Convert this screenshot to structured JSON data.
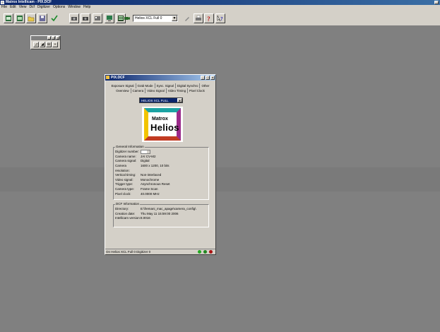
{
  "app": {
    "title": "Matrox Intellicam - PIX.DCF"
  },
  "menu": [
    "File",
    "Edit",
    "View",
    "Dcf",
    "Digitizer",
    "Options",
    "Window",
    "Help"
  ],
  "toolbar": {
    "digitizer_combo": "Helios XCL Full 0",
    "combo_arrow": "▼"
  },
  "palette": {
    "buttons": [
      "◿",
      "◢",
      "⊞",
      "▪"
    ],
    "ctrl": [
      "_",
      "□",
      "×"
    ]
  },
  "dcf_window": {
    "title": "PIX.DCF",
    "controls": [
      "_",
      "□",
      "×"
    ],
    "tabs_row1": [
      "Exposure Signal",
      "Grab Mode",
      "Sync. Signal",
      "Digital Synchro",
      "Other"
    ],
    "tabs_row2": [
      "Overview",
      "Camera",
      "Video Signal",
      "Video Timing",
      "Pixel Clock"
    ],
    "board": "HELIOS XCL FULL",
    "board_arrow": "▼",
    "logo_top": "Matrox",
    "logo_main": "Helios",
    "general": {
      "title": "General Information",
      "rows": [
        {
          "k": "Digitizer number:",
          "v": ""
        },
        {
          "k": "Camera name:",
          "v": "JAI CV-M2"
        },
        {
          "k": "Camera signal:",
          "v": "Digital"
        },
        {
          "k": "Camera resolution:",
          "v": "1600 x 1200, 10 bits"
        },
        {
          "k": "Vertical timing:",
          "v": "Non-interlaced"
        },
        {
          "k": "Video signal:",
          "v": "Monochrome"
        },
        {
          "k": "Trigger type:",
          "v": "Asynchronous Reset"
        },
        {
          "k": "Camera type:",
          "v": "Frame Scan"
        },
        {
          "k": "Pixel clock:",
          "v": "40.0000 MHz"
        }
      ]
    },
    "dcf": {
      "title": "DCF Information",
      "rows": [
        {
          "k": "Directory:",
          "v": "E:\\fremani_mac_apage\\camera_config\\"
        },
        {
          "k": "Creation date:",
          "v": "Thu May 11 15:59:00 2006"
        },
        {
          "k": "Intellicam version:",
          "v": "8.0016"
        }
      ]
    },
    "status": "On Helios XCL Full 0 Digitizer 0",
    "leds": [
      "#22aa22",
      "#228822",
      "#aa1111"
    ]
  }
}
